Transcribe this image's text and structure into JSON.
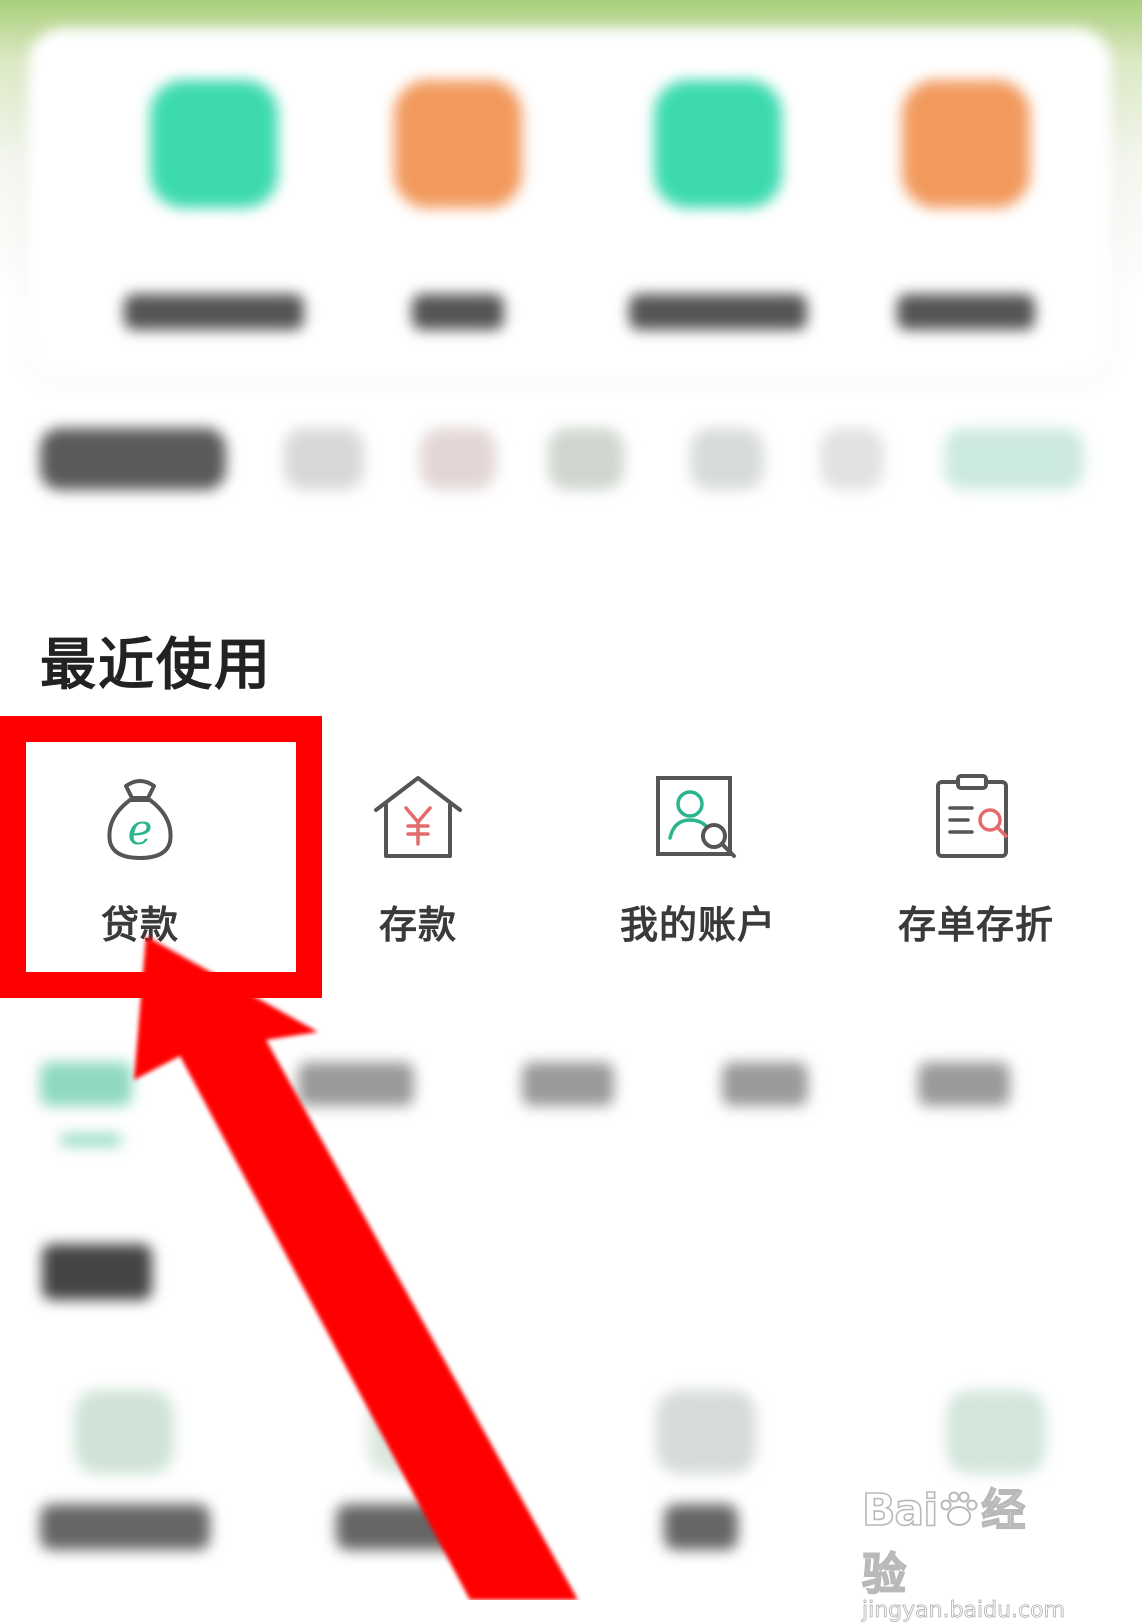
{
  "colors": {
    "teal_tile": "#3ddab0",
    "orange_tile": "#f29a5e",
    "highlight": "#ff0000",
    "icon_teal": "#2bb58f",
    "icon_red": "#e56a6a",
    "icon_gray": "#555555"
  },
  "quick_menu": {
    "items": [
      {
        "icon": "teal-app-icon"
      },
      {
        "icon": "orange-app-icon"
      },
      {
        "icon": "teal-app-icon"
      },
      {
        "icon": "orange-app-icon"
      }
    ]
  },
  "recent": {
    "title": "最近使用",
    "items": [
      {
        "label": "贷款",
        "icon": "money-bag-icon"
      },
      {
        "label": "存款",
        "icon": "house-yuan-icon"
      },
      {
        "label": "我的账户",
        "icon": "user-search-icon"
      },
      {
        "label": "存单存折",
        "icon": "clipboard-search-icon"
      }
    ]
  },
  "annotation": {
    "target": "贷款",
    "shapes": [
      "red-highlight-box",
      "red-arrow"
    ]
  },
  "watermark": {
    "brand_left": "Bai",
    "brand_right": "经验",
    "sub": "jingyan.baidu.com"
  }
}
